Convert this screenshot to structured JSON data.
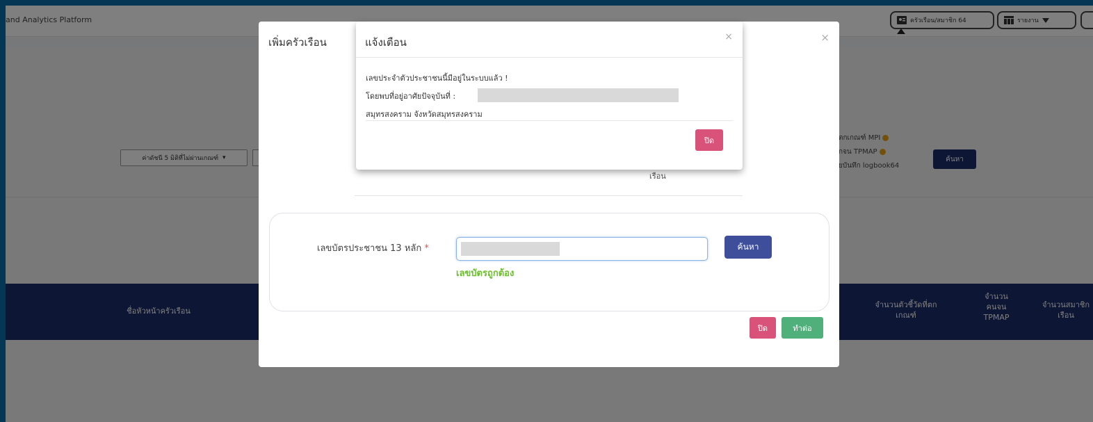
{
  "app": {
    "title": "and Analytics Platform"
  },
  "topbar": {
    "household_button": "ครัวเรือน/สมาชิก 64",
    "report_button": "รายงาน"
  },
  "filters": {
    "indicator_select": "ค่าดัชนี 5 มิติที่ไม่ผ่านเกณฑ์",
    "right_lines": [
      "ตกเกณฑ์ MPI",
      "กจน TPMAP",
      "ยบันทึก logbook64"
    ],
    "search_label": "ค้นหา"
  },
  "table": {
    "headers": [
      "ชื่อหัวหน้าครัวเรือน",
      "จำนวนตัวชี้วัดที่ตก\nเกณฑ์",
      "จำนวน\nคนจน\nTPMAP",
      "จำนวนสมาชิก\nเรือน"
    ]
  },
  "modal": {
    "title": "เพิ่มครัวเรือน",
    "close_symbol": "×",
    "faded_text": "เรือน",
    "id_label": "เลขบัตรประชาชน 13 หลัก",
    "required_mark": "*",
    "search_label": "ค้นหา",
    "validation_message": "เลขบัตรถูกต้อง",
    "close_label": "ปิด",
    "continue_label": "ทำต่อ"
  },
  "alert": {
    "title": "แจ้งเตือน",
    "close_symbol": "×",
    "line1": "เลขประจำตัวประชาชนนี้มีอยู่ในระบบแล้ว !",
    "line2": "โดยพบที่อยู่อาศัยปัจจุบันที่ :",
    "line3": "สมุทรสงคราม จังหวัดสมุทรสงคราม",
    "close_label": "ปิด"
  },
  "colors": {
    "navy": "#1a2d6b",
    "primary": "#3f4e9b",
    "pink": "#d9527a",
    "green": "#4fb07c",
    "valid": "#6abf2a"
  }
}
